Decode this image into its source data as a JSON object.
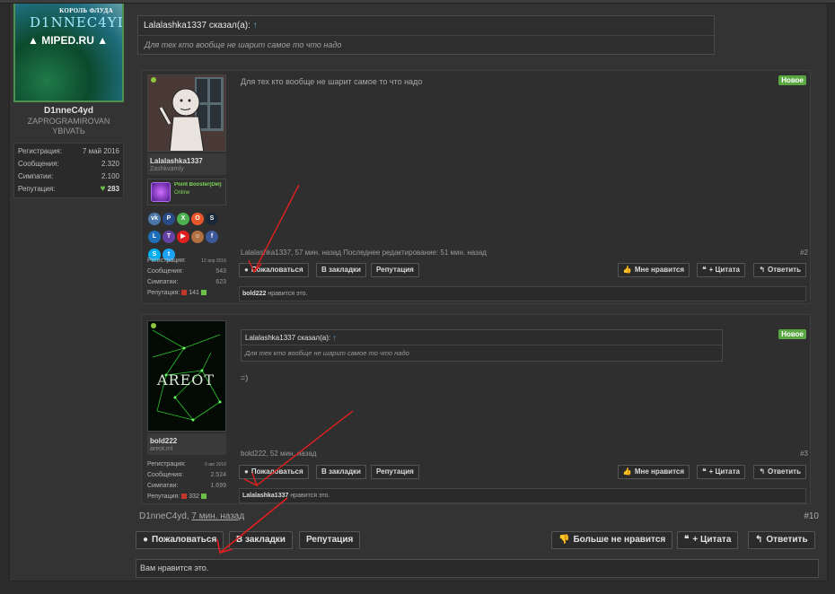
{
  "sidebar_user": {
    "avatar_line1": "КОРОЛЬ ФЛУДА",
    "avatar_line2": "D1NNEC4YD",
    "avatar_line3": "▲ MIPED.RU ▲",
    "name": "D1nneC4yd",
    "title_line1": "ZAPROGRAMIROVAN",
    "title_line2": "YBIVATЬ",
    "stats": [
      {
        "label": "Регистрация:",
        "value": "7 май 2016"
      },
      {
        "label": "Сообщения:",
        "value": "2.320"
      },
      {
        "label": "Симпатии:",
        "value": "2.100"
      },
      {
        "label": "Репутация:",
        "value": "283"
      }
    ]
  },
  "top_quote": {
    "author": "Lalalashka1337 сказал(а):",
    "text": "Для тех кто вообще не шарит самое то что надо"
  },
  "post2": {
    "author": "Lalalashka1337",
    "title": "Zashkvarnly",
    "booster_name": "Point Booster(Del)",
    "booster_status": "Online",
    "text": "Для тех кто вообще не шарит самое то что надо",
    "badge": "Новое",
    "meta": "Lalalashka1337, 57 мин. назад Последнее редактирование: 51 мин. назад",
    "number": "#2",
    "stats": [
      {
        "label": "Регистрация:",
        "value": "12 апр 2016"
      },
      {
        "label": "Сообщения:",
        "value": "543"
      },
      {
        "label": "Симпатии:",
        "value": "623"
      },
      {
        "label": "Репутация:",
        "value": "141"
      }
    ],
    "buttons": {
      "report": "Пожаловаться",
      "bookmark": "В закладки",
      "reputation": "Репутация",
      "like": "Мне нравится",
      "quote": "+ Цитата",
      "reply": "Ответить"
    },
    "likes_user": "bold222",
    "likes_text": " нравится это."
  },
  "post3": {
    "author": "bold222",
    "title": "areot.ml",
    "avatar_text": "AREOT",
    "quote_author": "Lalalashka1337 сказал(а):",
    "quote_text": "Для тех кто вообще не шарит самое то что надо",
    "text": "=)",
    "badge": "Новое",
    "meta": "bold222, 52 мин. назад",
    "number": "#3",
    "stats": [
      {
        "label": "Регистрация:",
        "value": "9 авг 2016"
      },
      {
        "label": "Сообщения:",
        "value": "2.524"
      },
      {
        "label": "Симпатии:",
        "value": "1.699"
      },
      {
        "label": "Репутация:",
        "value": "332"
      }
    ],
    "buttons": {
      "report": "Пожаловаться",
      "bookmark": "В закладки",
      "reputation": "Репутация",
      "like": "Мне нравится",
      "quote": "+ Цитата",
      "reply": "Ответить"
    },
    "likes_user": "Lalalashka1337",
    "likes_text": " нравится это."
  },
  "main_post": {
    "author": "D1nneC4yd",
    "date": "7 мин. назад",
    "number": "#10",
    "buttons": {
      "report": "Пожаловаться",
      "bookmark": "В закладки",
      "reputation": "Репутация",
      "unlike": "Больше не нравится",
      "quote": "+ Цитата",
      "reply": "Ответить"
    },
    "you_like": "Вам нравится это."
  },
  "colors": {
    "accent_green": "#59a741",
    "arrow_red": "#e02020",
    "link_blue": "#5aa9e6"
  }
}
